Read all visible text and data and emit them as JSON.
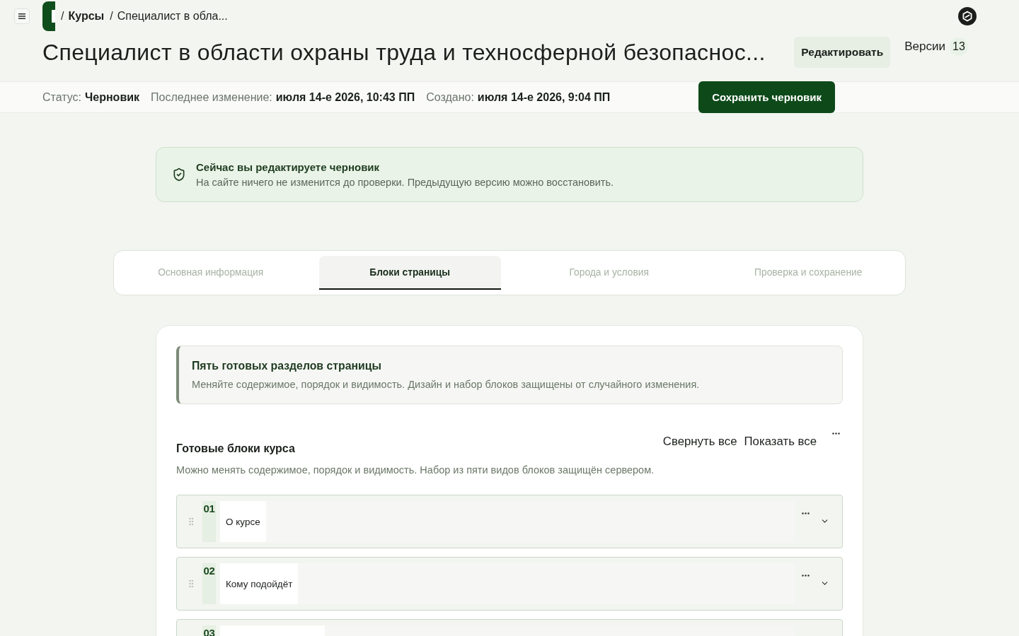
{
  "top_bar": {
    "breadcrumbs": [
      {
        "separator": "/",
        "label": "Курсы",
        "current": false
      },
      {
        "separator": "/",
        "label": "Специалист в обла...",
        "current": true
      }
    ]
  },
  "header": {
    "title": "Специалист в области охраны труда и техносферной безопаснос...",
    "edit_button": "Редактировать",
    "versions": {
      "label": "Версии",
      "count": "13"
    }
  },
  "meta": [
    {
      "label": "Статус:",
      "value": "Черновик"
    },
    {
      "label": "Последнее изменение:",
      "value": "июля 14-е 2026, 10:43 ПП"
    },
    {
      "label": "Создано:",
      "value": "июля 14-е 2026, 9:04 ПП"
    }
  ],
  "save_button": "Сохранить черновик",
  "notice": {
    "title": "Сейчас вы редактируете черновик",
    "text": "На сайте ничего не изменится до проверки. Предыдущую версию можно восстановить."
  },
  "tabs": [
    {
      "label": "Основная информация",
      "selected": false
    },
    {
      "label": "Блоки страницы",
      "selected": true
    },
    {
      "label": "Города и условия",
      "selected": false
    },
    {
      "label": "Проверка и сохранение",
      "selected": false
    }
  ],
  "content": {
    "info": {
      "title": "Пять готовых разделов страницы",
      "text": "Меняйте содержимое, порядок и видимость. Дизайн и набор блоков защищены от случайного изменения."
    },
    "section": {
      "title": "Готовые блоки курса",
      "description": "Можно менять содержимое, порядок и видимость. Набор из пяти видов блоков защищён сервером.",
      "actions": [
        "Свернуть все",
        "Показать все"
      ]
    },
    "blocks": [
      {
        "number": "01",
        "title": "О курсе"
      },
      {
        "number": "02",
        "title": "Кому подойдёт"
      },
      {
        "number": "03"
      }
    ]
  }
}
